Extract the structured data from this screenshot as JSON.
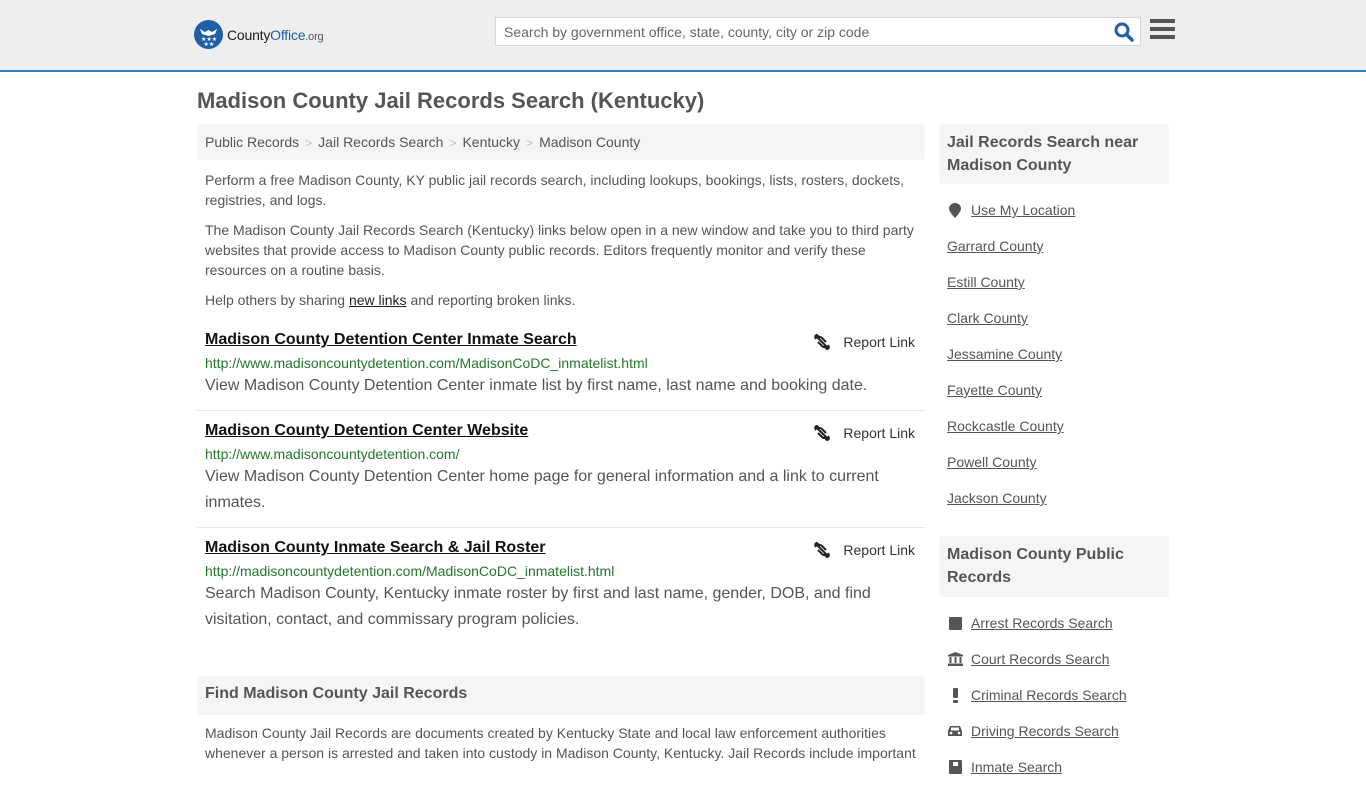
{
  "header": {
    "logo": {
      "county": "County",
      "office": "Office",
      "org": ".org"
    },
    "search_placeholder": "Search by government office, state, county, city or zip code",
    "search_icon": "search-icon",
    "menu_icon": "hamburger-menu-icon"
  },
  "page_title": "Madison County Jail Records Search (Kentucky)",
  "breadcrumb": [
    "Public Records",
    "Jail Records Search",
    "Kentucky",
    "Madison County"
  ],
  "intro": {
    "p1": "Perform a free Madison County, KY public jail records search, including lookups, bookings, lists, rosters, dockets, registries, and logs.",
    "p2": "The Madison County Jail Records Search (Kentucky) links below open in a new window and take you to third party websites that provide access to Madison County public records. Editors frequently monitor and verify these resources on a routine basis.",
    "p3_before": "Help others by sharing ",
    "p3_link": "new links",
    "p3_after": " and reporting broken links."
  },
  "results": [
    {
      "title": "Madison County Detention Center Inmate Search",
      "url": "http://www.madisoncountydetention.com/MadisonCoDC_inmatelist.html",
      "description": "View Madison County Detention Center inmate list by first name, last name and booking date.",
      "report_label": "Report Link"
    },
    {
      "title": "Madison County Detention Center Website",
      "url": "http://www.madisoncountydetention.com/",
      "description": "View Madison County Detention Center home page for general information and a link to current inmates.",
      "report_label": "Report Link"
    },
    {
      "title": "Madison County Inmate Search & Jail Roster",
      "url": "http://madisoncountydetention.com/MadisonCoDC_inmatelist.html",
      "description": "Search Madison County, Kentucky inmate roster by first and last name, gender, DOB, and find visitation, contact, and commissary program policies.",
      "report_label": "Report Link"
    }
  ],
  "find_section": {
    "heading": "Find Madison County Jail Records",
    "text": "Madison County Jail Records are documents created by Kentucky State and local law enforcement authorities whenever a person is arrested and taken into custody in Madison County, Kentucky. Jail Records include important"
  },
  "sidebar": {
    "nearby_heading": "Jail Records Search near Madison County",
    "use_location": "Use My Location",
    "nearby": [
      "Garrard County",
      "Estill County",
      "Clark County",
      "Jessamine County",
      "Fayette County",
      "Rockcastle County",
      "Powell County",
      "Jackson County"
    ],
    "public_heading": "Madison County Public Records",
    "public_records": [
      {
        "label": "Arrest Records Search",
        "icon": "square-icon"
      },
      {
        "label": "Court Records Search",
        "icon": "courthouse-icon"
      },
      {
        "label": "Criminal Records Search",
        "icon": "exclamation-icon"
      },
      {
        "label": "Driving Records Search",
        "icon": "car-icon"
      },
      {
        "label": "Inmate Search",
        "icon": "inmate-icon"
      }
    ]
  },
  "colors": {
    "accent": "#337ab7",
    "url_green": "#25772b",
    "brand_blue": "#1f5fa6"
  }
}
